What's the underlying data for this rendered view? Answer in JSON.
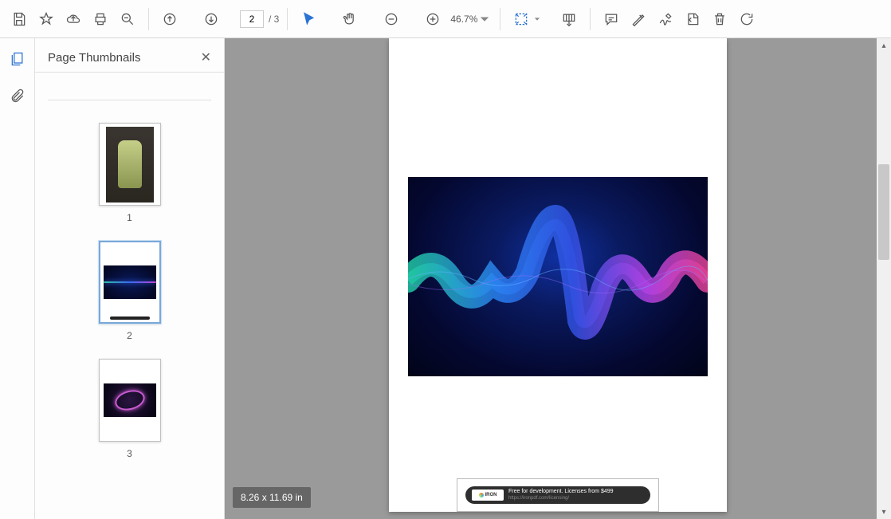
{
  "toolbar": {
    "page_current": "2",
    "page_total": "/ 3",
    "zoom_level": "46.7%"
  },
  "side_panel": {
    "title": "Page Thumbnails",
    "thumbs": [
      {
        "num": "1"
      },
      {
        "num": "2"
      },
      {
        "num": "3"
      }
    ]
  },
  "banner": {
    "logo_text": "IRON",
    "line1": "Free for development. Licenses from $499",
    "line2": "https://ironpdf.com/licensing/"
  },
  "status": {
    "dimensions": "8.26 x 11.69 in"
  }
}
